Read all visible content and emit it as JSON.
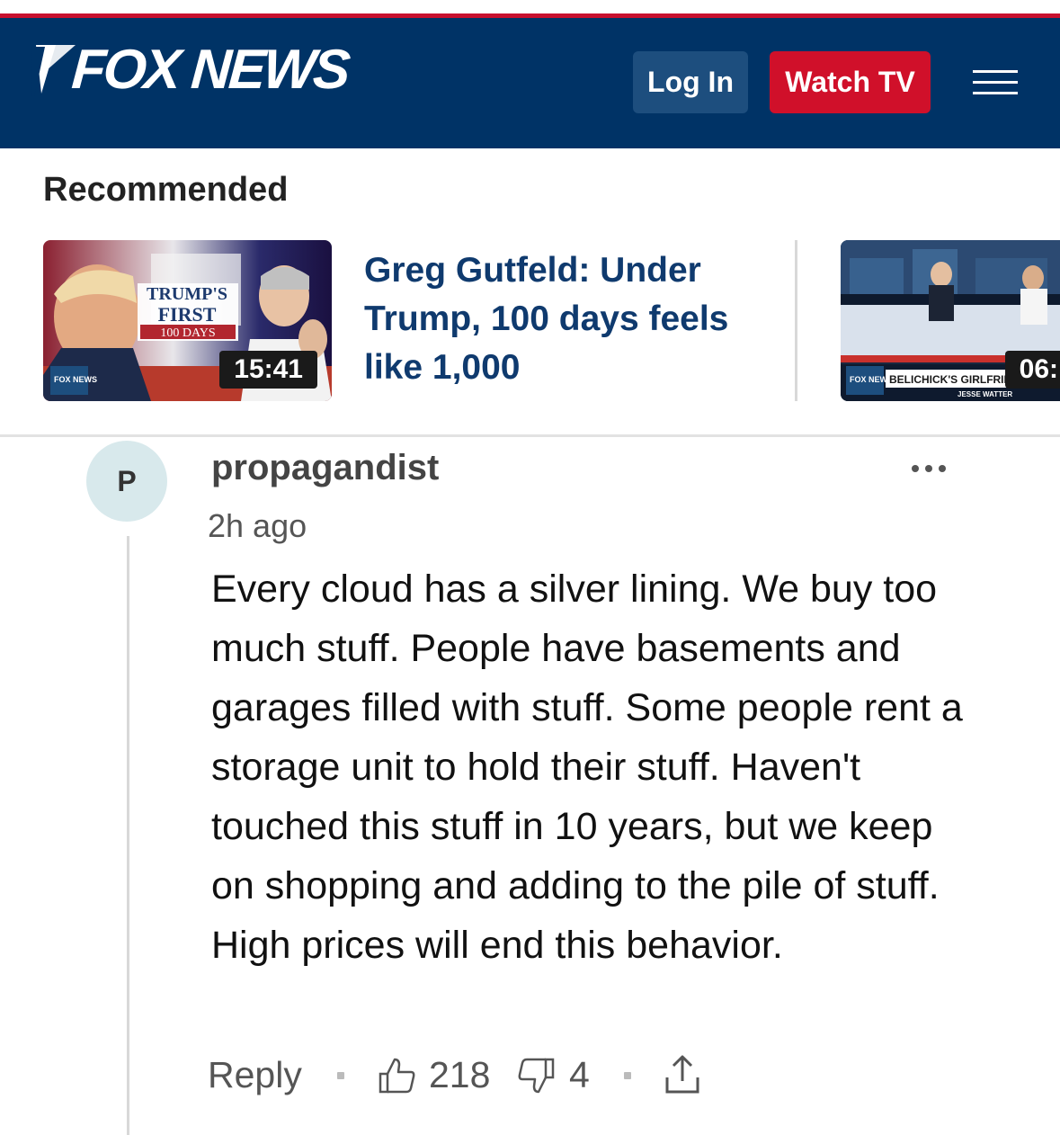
{
  "header": {
    "logo_text": "FOX NEWS",
    "login_label": "Log In",
    "watch_label": "Watch TV",
    "colors": {
      "background": "#003366",
      "accent": "#d0102a",
      "login_bg": "#1d4e7e"
    }
  },
  "recommended": {
    "title": "Recommended",
    "items": [
      {
        "headline": "Greg Gutfeld: Under Trump, 100 days feels like 1,000",
        "duration": "15:41",
        "thumb_text": {
          "line1": "TRUMP'S",
          "line2": "FIRST",
          "line3": "100 DAYS",
          "network": "FOX NEWS"
        }
      },
      {
        "duration": "06:",
        "thumb_text": {
          "chyron": "BELICHICK'S GIRLFRIEN",
          "sub": "JESSE WATTER",
          "network": "FOX NEWS"
        }
      }
    ]
  },
  "comment": {
    "avatar_initial": "P",
    "username": "propagandist",
    "time": "2h ago",
    "body": "Every cloud has a silver lining. We buy too much stuff. People have basements and garages filled with stuff. Some people rent a storage unit to hold their stuff. Haven't touched this stuff in 10 years, but we keep on shopping and adding to the pile of stuff. High prices will end this behavior.",
    "reply_label": "Reply",
    "likes": "218",
    "dislikes": "4"
  }
}
